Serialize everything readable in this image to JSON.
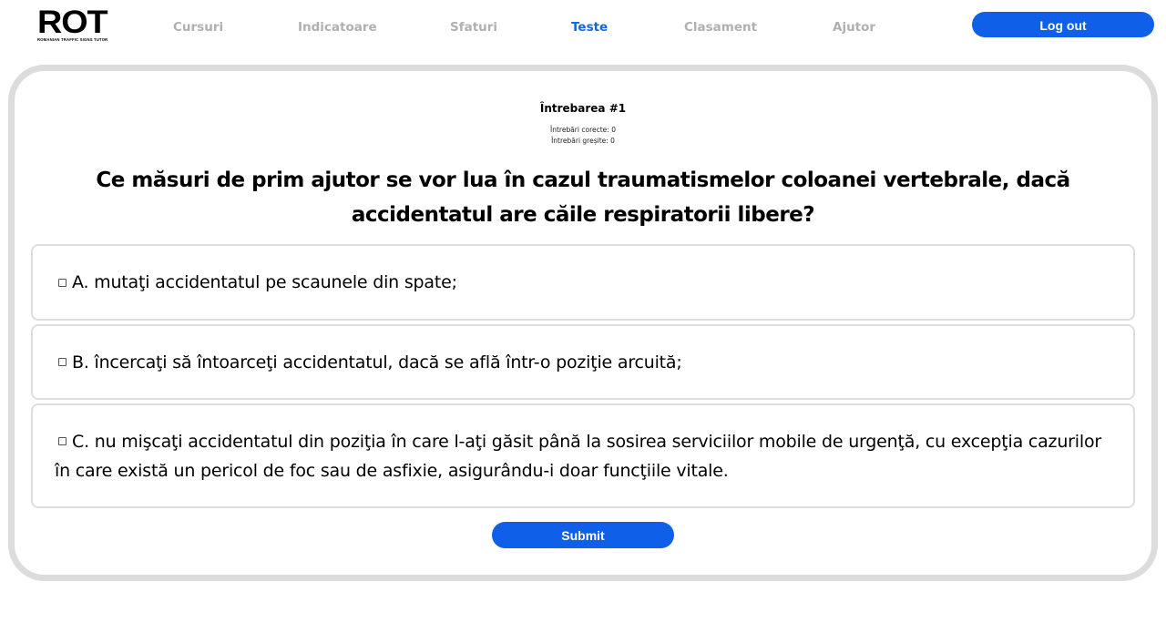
{
  "logo": {
    "main": "ROT",
    "subtitle": "ROMANIAN TRAFFIC SIGNS TUTOR"
  },
  "nav": {
    "items": [
      {
        "label": "Cursuri"
      },
      {
        "label": "Indicatoare"
      },
      {
        "label": "Sfaturi"
      },
      {
        "label": "Teste",
        "active": true
      },
      {
        "label": "Clasament"
      },
      {
        "label": "Ajutor"
      }
    ],
    "logout_label": "Log out"
  },
  "quiz": {
    "question_number": "Întrebarea #1",
    "correct_label": "Întrebări corecte: 0",
    "wrong_label": "Întrebări greșite: 0",
    "question": "Ce măsuri de prim ajutor se vor lua în cazul traumatismelor coloanei vertebrale, dacă accidentatul are căile respiratorii libere?",
    "answers": [
      {
        "text": "A. mutaţi accidentatul pe scaunele din spate;",
        "checked": false
      },
      {
        "text": "B. încercaţi să întoarceţi accidentatul, dacă se află într-o poziţie arcuită;",
        "checked": false
      },
      {
        "text": "C. nu mişcaţi accidentatul din poziţia în care l-aţi găsit până la sosirea serviciilor mobile de urgenţă, cu excepţia cazurilor în care există un pericol de foc sau de asfixie, asigurându-i doar funcţiile vitale.",
        "checked": false
      }
    ],
    "submit_label": "Submit"
  },
  "colors": {
    "accent": "#0f5fe8",
    "nav_active": "#1565e0",
    "nav_inactive": "#b0b0b0",
    "card_border": "#dcdcdc",
    "answer_border": "#dedede"
  },
  "icons": {
    "answer_checkbox": "checkbox-icon"
  }
}
